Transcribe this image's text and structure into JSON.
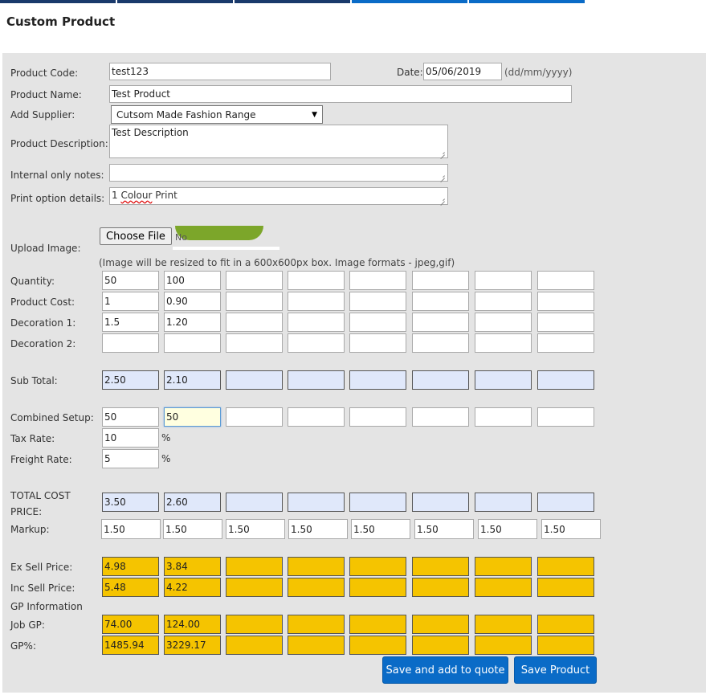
{
  "nav": {
    "colors": [
      "#1a3a6b",
      "#1a3a6b",
      "#1a3a6b",
      "#0a6bc7",
      "#0a6bc7"
    ]
  },
  "page_title": "Custom Product",
  "form": {
    "product_code": {
      "label": "Product Code:",
      "value": "test123"
    },
    "date": {
      "label": "Date:",
      "value": "05/06/2019",
      "hint": "(dd/mm/yyyy)"
    },
    "product_name": {
      "label": "Product Name:",
      "value": "Test Product"
    },
    "supplier": {
      "label": "Add Supplier:",
      "value": "Cutsom Made Fashion Range"
    },
    "description": {
      "label": "Product Description:",
      "value": "Test Description"
    },
    "internal_notes": {
      "label": "Internal only notes:",
      "value": ""
    },
    "print_options": {
      "label": "Print option details:",
      "value": "1 Colour Print",
      "misspelled": "Colour"
    },
    "upload": {
      "label": "Upload Image:",
      "button": "Choose File",
      "status": "No",
      "hint": "(Image will be resized to fit in a 600x600px box. Image formats - jpeg,gif)"
    }
  },
  "pricing": {
    "rows": [
      {
        "key": "quantity",
        "label": "Quantity:",
        "style": "white",
        "values": [
          "50",
          "100",
          "",
          "",
          "",
          "",
          "",
          ""
        ]
      },
      {
        "key": "product_cost",
        "label": "Product Cost:",
        "style": "white",
        "values": [
          "1",
          "0.90",
          "",
          "",
          "",
          "",
          "",
          ""
        ]
      },
      {
        "key": "decoration1",
        "label": "Decoration 1:",
        "style": "white",
        "values": [
          "1.5",
          "1.20",
          "",
          "",
          "",
          "",
          "",
          ""
        ]
      },
      {
        "key": "decoration2",
        "label": "Decoration 2:",
        "style": "white",
        "values": [
          "",
          "",
          "",
          "",
          "",
          "",
          "",
          ""
        ]
      },
      {
        "key": "sub_total",
        "label": "Sub Total:",
        "style": "blue",
        "values": [
          "2.50",
          "2.10",
          "",
          "",
          "",
          "",
          "",
          ""
        ]
      },
      {
        "key": "combined_setup",
        "label": "Combined Setup:",
        "style": "white",
        "values": [
          "50",
          "50",
          "",
          "",
          "",
          "",
          "",
          ""
        ]
      },
      {
        "key": "total_cost",
        "label": "TOTAL COST PRICE:",
        "style": "blue",
        "values": [
          "3.50",
          "2.60",
          "",
          "",
          "",
          "",
          "",
          ""
        ]
      },
      {
        "key": "markup",
        "label": "Markup:",
        "style": "white",
        "values": [
          "1.50",
          "1.50",
          "1.50",
          "1.50",
          "1.50",
          "1.50",
          "1.50",
          "1.50"
        ]
      },
      {
        "key": "ex_sell",
        "label": "Ex Sell Price:",
        "style": "yellow",
        "values": [
          "4.98",
          "3.84",
          "",
          "",
          "",
          "",
          "",
          ""
        ]
      },
      {
        "key": "inc_sell",
        "label": "Inc Sell Price:",
        "style": "yellow",
        "values": [
          "5.48",
          "4.22",
          "",
          "",
          "",
          "",
          "",
          ""
        ]
      },
      {
        "key": "job_gp",
        "label": "Job GP:",
        "style": "yellow",
        "values": [
          "74.00",
          "124.00",
          "",
          "",
          "",
          "",
          "",
          ""
        ]
      },
      {
        "key": "gp_pct",
        "label": "GP%:",
        "style": "yellow",
        "values": [
          "1485.94",
          "3229.17",
          "",
          "",
          "",
          "",
          "",
          ""
        ]
      }
    ],
    "tax_rate": {
      "label": "Tax Rate:",
      "value": "10",
      "unit": "%"
    },
    "freight_rate": {
      "label": "Freight Rate:",
      "value": "5",
      "unit": "%"
    },
    "gp_info_label": "GP Information"
  },
  "actions": {
    "save_and_add": "Save and add to quote",
    "save_product": "Save Product"
  }
}
